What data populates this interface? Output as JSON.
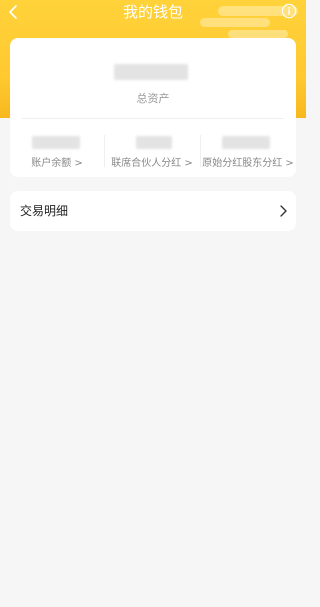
{
  "header": {
    "title": "我的钱包",
    "back_icon": "chevron-left-icon",
    "info_icon": "info-icon",
    "accent": "#ffc930"
  },
  "assets": {
    "total_label": "总资产",
    "columns": [
      {
        "label": "账户余额 >"
      },
      {
        "label": "联席合伙人分红 >"
      },
      {
        "label": "原始分红股东分红 >"
      }
    ]
  },
  "transactions": {
    "label": "交易明细",
    "chevron_icon": "chevron-right-icon"
  }
}
